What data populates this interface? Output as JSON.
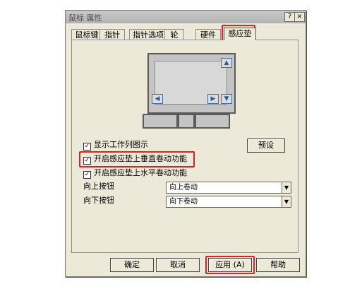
{
  "window": {
    "title": "鼠标 属性",
    "help_btn": "?",
    "close_btn": "×"
  },
  "tabs": [
    {
      "label": "鼠标键"
    },
    {
      "label": "指针"
    },
    {
      "label": "指针选项"
    },
    {
      "label": "轮"
    },
    {
      "label": "硬件"
    },
    {
      "label": "感应垫"
    }
  ],
  "options": {
    "show_tray_icon": "显示工作列图示",
    "vertical_scroll": "开启感应垫上垂直卷动功能",
    "horizontal_scroll": "开启感应垫上水平卷动功能",
    "checkmark": "✓"
  },
  "preset_button": "预设",
  "up_button": {
    "label": "向上按钮",
    "value": "向上卷动"
  },
  "down_button": {
    "label": "向下按钮",
    "value": "向下卷动"
  },
  "footer": {
    "ok": "确定",
    "cancel": "取消",
    "apply": "应用 (A)",
    "help": "帮助"
  },
  "colors": {
    "highlight": "#e02020"
  }
}
